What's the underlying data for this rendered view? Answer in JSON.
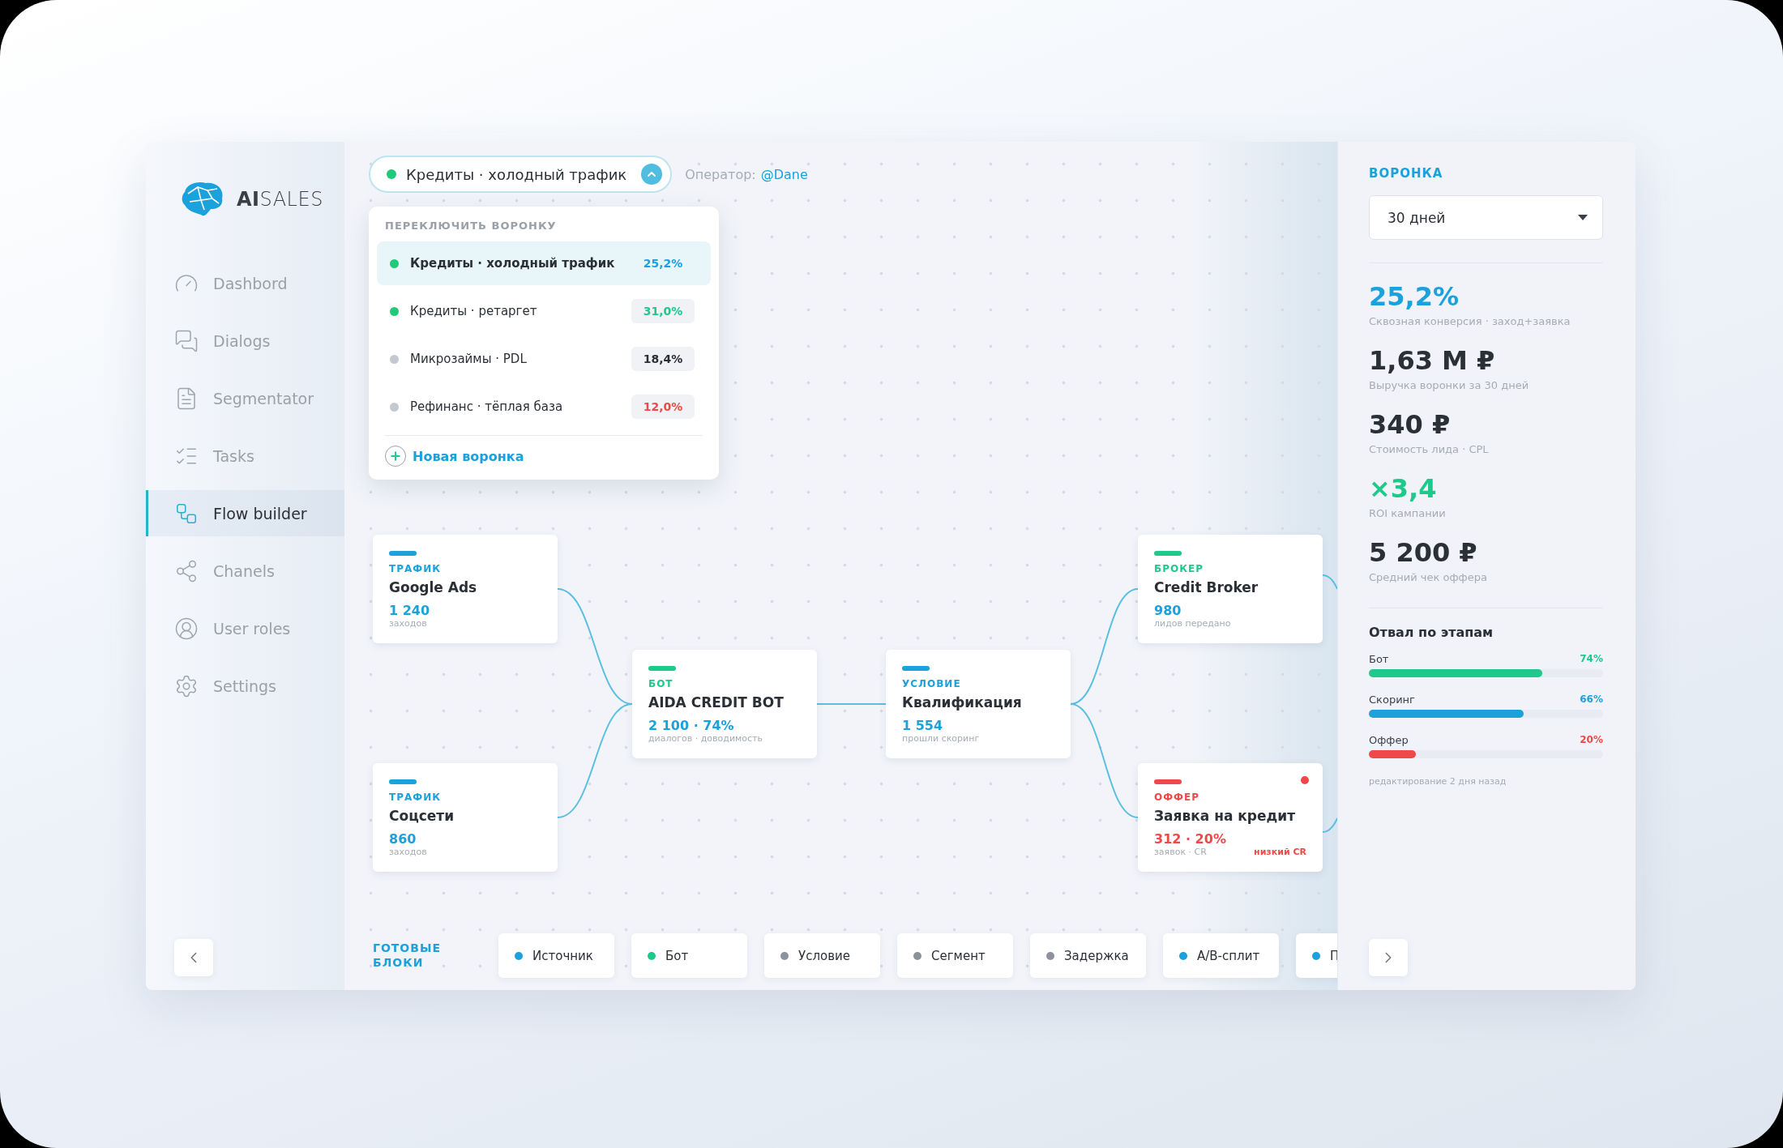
{
  "sidebar": {
    "logo": "**AI**SALES",
    "items": [
      {
        "label": "Dashbord",
        "selected": false
      },
      {
        "label": "Dialogs",
        "selected": false
      },
      {
        "label": "Segmentator",
        "selected": false
      },
      {
        "label": "Tasks",
        "selected": false
      },
      {
        "label": "Flow builder",
        "selected": true
      },
      {
        "label": "Chanels",
        "selected": false
      },
      {
        "label": "User roles",
        "selected": false
      },
      {
        "label": "Settings",
        "selected": false
      }
    ]
  },
  "funnel_switch": {
    "label": "Кредиты · холодный трафик",
    "color": "#22c97a",
    "expanded": true
  },
  "operator": {
    "label": "Оператор:",
    "user": "@Dane"
  },
  "funnel_menu": {
    "title": "ПЕРЕКЛЮЧИТЬ ВОРОНКУ",
    "items": [
      {
        "label": "Кредиты · холодный трафик",
        "color": "#22c97a",
        "value": {
          "text": "25,2%",
          "color": "#1ba1dc"
        },
        "selected": true
      },
      {
        "label": "Кредиты · ретаргет",
        "color": "#22c97a",
        "value": {
          "text": "31,0%",
          "color": "#1fc98b"
        },
        "selected": false
      },
      {
        "label": "Микрозаймы · PDL",
        "color": "#c4c8cf",
        "value": {
          "text": "18,4%",
          "color": "#2b2f36"
        },
        "selected": false
      },
      {
        "label": "Рефинанс · тёплая база",
        "color": "#c4c8cf",
        "value": {
          "text": "12,0%",
          "color": "#f04848"
        },
        "selected": false
      }
    ],
    "new_button": "Новая воронка"
  },
  "nodes": [
    {
      "type": "ТРАФИК",
      "title": "Google Ads",
      "metric": "1 240",
      "caption": "заходов",
      "color": "#1ba1dc",
      "alert": false
    },
    {
      "type": "ТРАФИК",
      "title": "Соцсети",
      "metric": "860",
      "caption": "заходов",
      "color": "#1ba1dc",
      "alert": false
    },
    {
      "type": "БОТ",
      "title": "AIDA CREDIT BOT",
      "metric": "2 100 · 74%",
      "caption": "диалогов · доводимость",
      "color": "#1fc98b",
      "alert": false
    },
    {
      "type": "УСЛОВИЕ",
      "title": "Квалификация",
      "metric": "1 554",
      "caption": "прошли скоринг",
      "color": "#1ba1dc",
      "alert": false
    },
    {
      "type": "БРОКЕР",
      "title": "Credit Broker",
      "metric": "980",
      "caption": "лидов передано",
      "color": "#1fc98b",
      "alert": false
    },
    {
      "type": "ОФФЕР",
      "title": "Заявка на кредит",
      "metric": "312 · 20%",
      "caption": "заявок · CR",
      "color": "#f04848",
      "alert": true,
      "warning": "низкий CR"
    }
  ],
  "palette": {
    "title": "ГОТОВЫЕ БЛОКИ",
    "items": [
      {
        "label": "Источник",
        "color": "#1ba1dc"
      },
      {
        "label": "Бот",
        "color": "#1fc98b"
      },
      {
        "label": "Условие",
        "color": "#8c929c"
      },
      {
        "label": "Сегмент",
        "color": "#8c929c"
      },
      {
        "label": "Задержка",
        "color": "#8c929c"
      },
      {
        "label": "А/В-сплит",
        "color": "#1ba1dc"
      },
      {
        "label": "П",
        "color": "#1ba1dc"
      }
    ]
  },
  "panel": {
    "title": "ВОРОНКА",
    "period": "30 дней",
    "metrics": [
      {
        "value": "25,2%",
        "label": "Сквозная конверсия · заход+заявка",
        "color": "#1ba1dc"
      },
      {
        "value": "1,63 М ₽",
        "label": "Выручка воронки за 30 дней",
        "color": "#2b2f36"
      },
      {
        "value": "340 ₽",
        "label": "Стоимость лида · CPL",
        "color": "#2b2f36"
      },
      {
        "value": "×3,4",
        "label": "ROI кампании",
        "color": "#1fc98b"
      },
      {
        "value": "5 200 ₽",
        "label": "Средний чек оффера",
        "color": "#2b2f36"
      }
    ],
    "stages_title": "Отвал по этапам",
    "stages": [
      {
        "label": "Бот",
        "percent": "74%",
        "level": 0.74,
        "color": "#1fc98b"
      },
      {
        "label": "Скоринг",
        "percent": "66%",
        "level": 0.66,
        "color": "#1ba1dc"
      },
      {
        "label": "Оффер",
        "percent": "20%",
        "level": 0.2,
        "color": "#f04848"
      }
    ],
    "footnote": "редактирование 2 дня назад"
  }
}
